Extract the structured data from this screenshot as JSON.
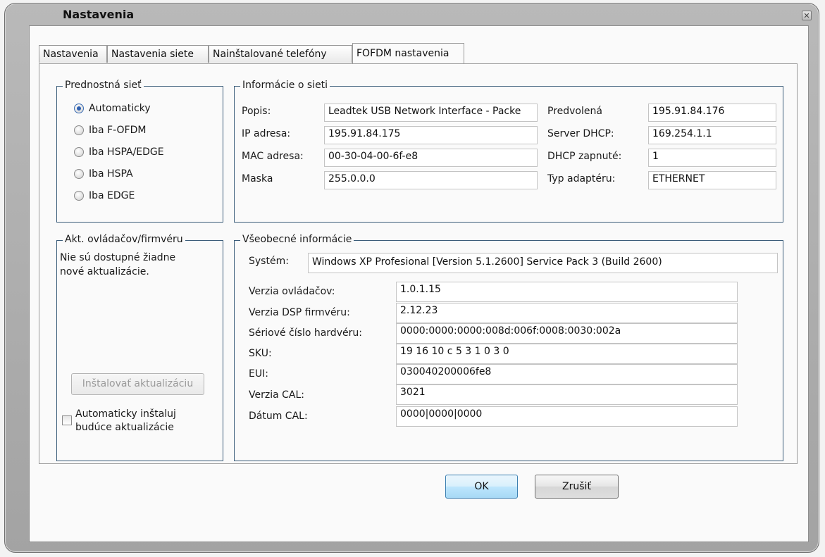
{
  "window": {
    "title": "Nastavenia",
    "close_glyph": "✕"
  },
  "tabs": [
    {
      "label": "Nastavenia"
    },
    {
      "label": "Nastavenia siete"
    },
    {
      "label": "Nainštalované telefóny"
    },
    {
      "label": "FOFDM nastavenia",
      "active": true
    }
  ],
  "preferred_network": {
    "legend": "Prednostná sieť",
    "options": [
      {
        "label": "Automaticky",
        "checked": true
      },
      {
        "label": "Iba F-OFDM",
        "checked": false
      },
      {
        "label": "Iba HSPA/EDGE",
        "checked": false
      },
      {
        "label": "Iba HSPA",
        "checked": false
      },
      {
        "label": "Iba EDGE",
        "checked": false
      }
    ]
  },
  "network_info": {
    "legend": "Informácie o sieti",
    "left": [
      {
        "label": "Popis:",
        "value": "Leadtek USB Network Interface - Packe"
      },
      {
        "label": "IP adresa:",
        "value": "195.91.84.175"
      },
      {
        "label": "MAC adresa:",
        "value": "00-30-04-00-6f-e8"
      },
      {
        "label": "Maska",
        "value": "255.0.0.0"
      }
    ],
    "right": [
      {
        "label": "Predvolená",
        "value": "195.91.84.176"
      },
      {
        "label": "Server DHCP:",
        "value": "169.254.1.1"
      },
      {
        "label": "DHCP zapnuté:",
        "value": "1"
      },
      {
        "label": "Typ adaptéru:",
        "value": "ETHERNET"
      }
    ]
  },
  "updates": {
    "legend": "Akt. ovládačov/firmvéru",
    "message_line1": "Nie sú dostupné žiadne",
    "message_line2": "nové aktualizácie.",
    "install_button": "Inštalovať aktualizáciu",
    "auto_install_line1": "Automaticky inštaluj",
    "auto_install_line2": "budúce aktualizácie",
    "auto_install_checked": false
  },
  "general_info": {
    "legend": "Všeobecné informácie",
    "system_label": "Systém:",
    "system_value": "Windows XP Profesional [Version 5.1.2600] Service Pack 3 (Build 2600)",
    "rows": [
      {
        "label": "Verzia ovládačov:",
        "value": "1.0.1.15"
      },
      {
        "label": "Verzia DSP firmvéru:",
        "value": "2.12.23"
      },
      {
        "label": "Sériové číslo hardvéru:",
        "value": "0000:0000:0000:008d:006f:0008:0030:002a"
      },
      {
        "label": "SKU:",
        "value": "19 16 10 c 5 3 1 0 3 0"
      },
      {
        "label": "EUI:",
        "value": "030040200006fe8"
      },
      {
        "label": "Verzia CAL:",
        "value": "3021"
      },
      {
        "label": "Dátum CAL:",
        "value": "0000|0000|0000"
      }
    ]
  },
  "buttons": {
    "ok": "OK",
    "cancel": "Zrušiť"
  }
}
